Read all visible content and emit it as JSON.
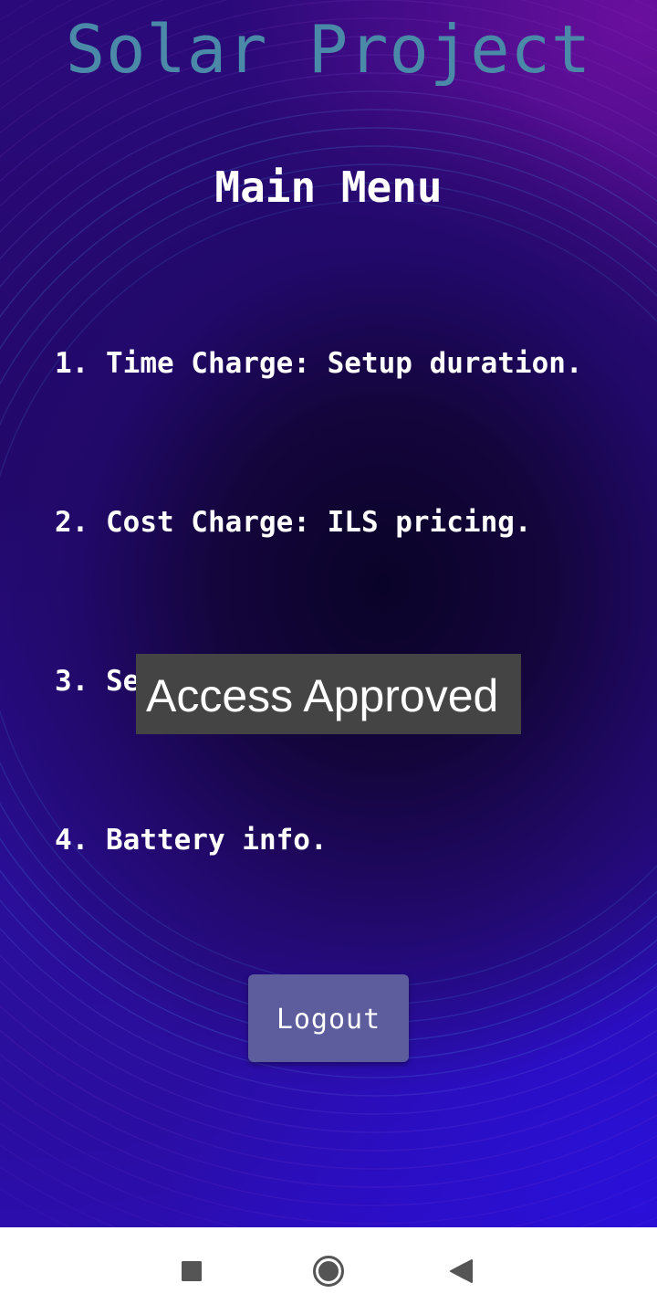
{
  "app": {
    "title": "Solar Project",
    "title_color": "#4a8aa8"
  },
  "menu": {
    "title": "Main Menu",
    "items": [
      {
        "label": "1. Time Charge: Setup duration."
      },
      {
        "label": "2. Cost Charge: ILS pricing."
      },
      {
        "label": "3. Se"
      },
      {
        "label": "4. Battery info."
      }
    ]
  },
  "toast": {
    "message": "Access Approved",
    "background": "#444444"
  },
  "logout": {
    "label": "Logout",
    "color": "#5d5d9e"
  },
  "navbar": {
    "icons": [
      "recents-square-icon",
      "home-circle-icon",
      "back-triangle-icon"
    ],
    "icon_color": "#555555"
  }
}
